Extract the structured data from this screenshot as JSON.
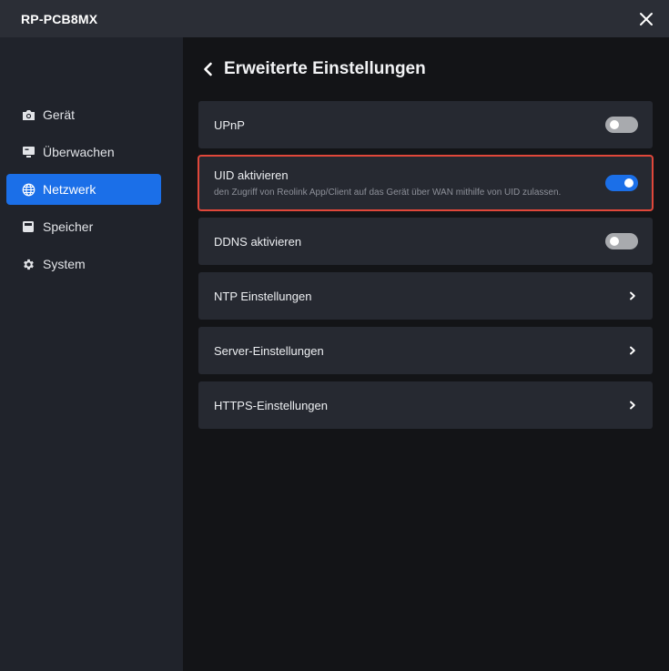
{
  "window": {
    "title": "RP-PCB8MX"
  },
  "sidebar": {
    "items": [
      {
        "label": "Gerät",
        "icon": "camera-icon",
        "active": false
      },
      {
        "label": "Überwachen",
        "icon": "monitor-icon",
        "active": false
      },
      {
        "label": "Netzwerk",
        "icon": "globe-icon",
        "active": true
      },
      {
        "label": "Speicher",
        "icon": "storage-icon",
        "active": false
      },
      {
        "label": "System",
        "icon": "gear-icon",
        "active": false
      }
    ]
  },
  "main": {
    "title": "Erweiterte Einstellungen",
    "rows": [
      {
        "label": "UPnP",
        "control": "toggle",
        "enabled": false
      },
      {
        "label": "UID aktivieren",
        "description": "den Zugriff von Reolink App/Client auf das Gerät über WAN mithilfe von UID zulassen.",
        "control": "toggle",
        "enabled": true,
        "highlighted": true
      },
      {
        "label": "DDNS aktivieren",
        "control": "toggle",
        "enabled": false
      },
      {
        "label": "NTP Einstellungen",
        "control": "chevron"
      },
      {
        "label": "Server-Einstellungen",
        "control": "chevron"
      },
      {
        "label": "HTTPS-Einstellungen",
        "control": "chevron"
      }
    ]
  },
  "colors": {
    "accent": "#1b6fe8",
    "highlight_border": "#e0473a",
    "toggle_off": "#a8aaae"
  }
}
